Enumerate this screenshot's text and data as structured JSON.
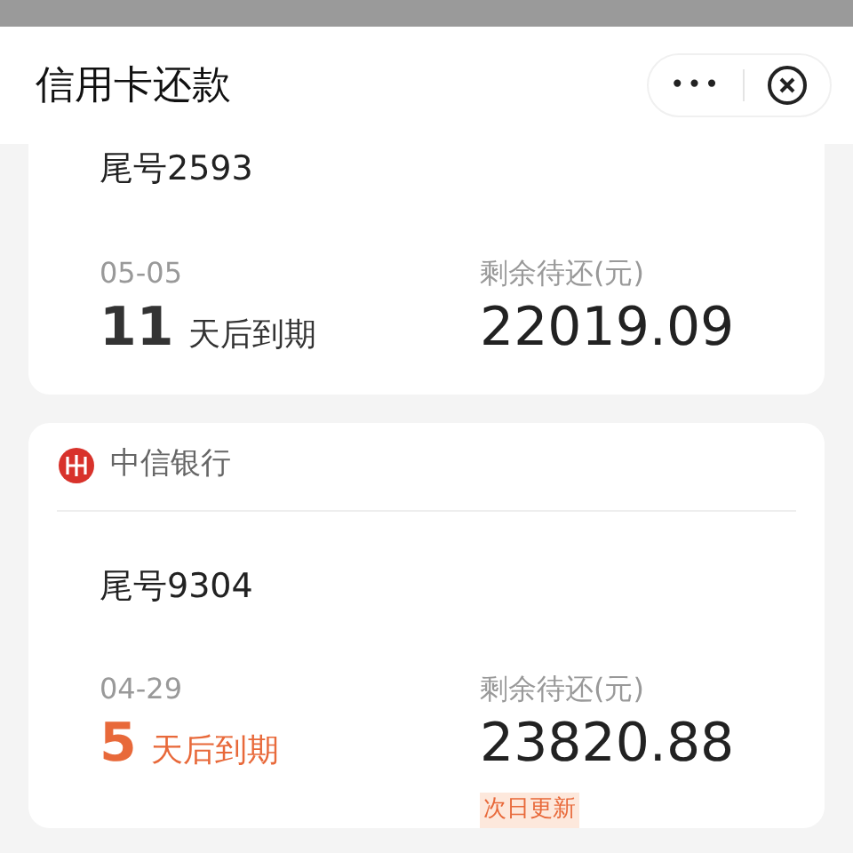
{
  "header": {
    "title": "信用卡还款",
    "more": "•••"
  },
  "cards": [
    {
      "tail": "尾号2593",
      "date": "05-05",
      "days": "11",
      "due_label": "天后到期",
      "urgent": false,
      "remaining_label": "剩余待还(元)",
      "amount": "22019.09"
    },
    {
      "bank": "中信银行",
      "tail": "尾号9304",
      "date": "04-29",
      "days": "5",
      "due_label": "天后到期",
      "urgent": true,
      "remaining_label": "剩余待还(元)",
      "amount": "23820.88",
      "note": "次日更新"
    }
  ]
}
